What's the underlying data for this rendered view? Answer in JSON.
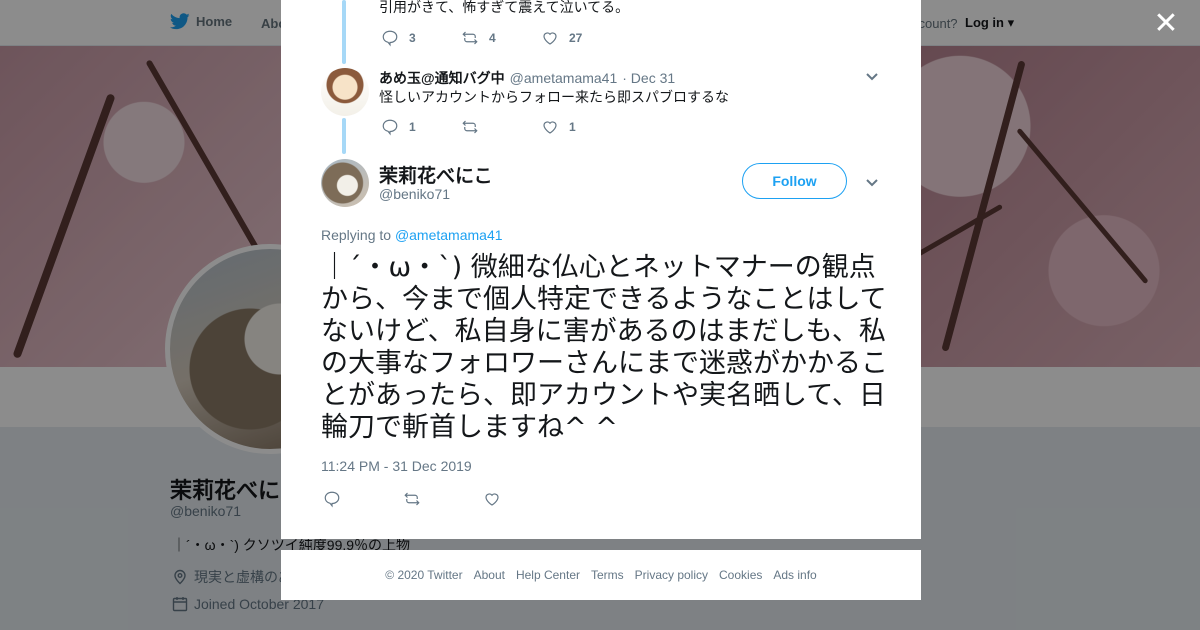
{
  "nav": {
    "home": "Home",
    "about": "Abo",
    "account_prompt": "ccount?",
    "login": "Log in"
  },
  "profile": {
    "name": "茉莉花べにこ",
    "handle": "@beniko71",
    "bio": "｜´・ω・`) クソツイ純度99.9％の上物",
    "location": "現実と虚構のあ",
    "joined": "Joined October 2017"
  },
  "thread": [
    {
      "text": "引用がきて、怖すぎて震えて泣いてる。",
      "reply_count": "3",
      "retweet_count": "4",
      "like_count": "27"
    },
    {
      "name": "あめ玉@通知バグ中",
      "handle": "@ametamama41",
      "date": "· Dec 31",
      "text": "怪しいアカウントからフォロー来たら即スパブロするな",
      "reply_count": "1",
      "retweet_count": "",
      "like_count": "1"
    }
  ],
  "main_tweet": {
    "name": "茉莉花べにこ",
    "handle": "@beniko71",
    "follow_label": "Follow",
    "replying_prefix": "Replying to",
    "replying_to": "@ametamama41",
    "text": "｜´・ω・`) 微細な仏心とネットマナーの観点から、今まで個人特定できるようなことはしてないけど、私自身に害があるのはまだしも、私の大事なフォロワーさんにまで迷惑がかかることがあったら、即アカウントや実名晒して、日輪刀で斬首しますね^ ^",
    "timestamp": "11:24 PM - 31 Dec 2019"
  },
  "footer": {
    "copyright": "© 2020 Twitter",
    "links": [
      "About",
      "Help Center",
      "Terms",
      "Privacy policy",
      "Cookies",
      "Ads info"
    ]
  },
  "colors": {
    "accent": "#1da1f2",
    "thread_line": "#a6d8f7",
    "muted": "#657786"
  },
  "icons": {
    "close": "close-icon",
    "reply": "reply-icon",
    "retweet": "retweet-icon",
    "like": "heart-icon",
    "more": "chevron-down-icon",
    "brand": "twitter-bird-icon"
  }
}
